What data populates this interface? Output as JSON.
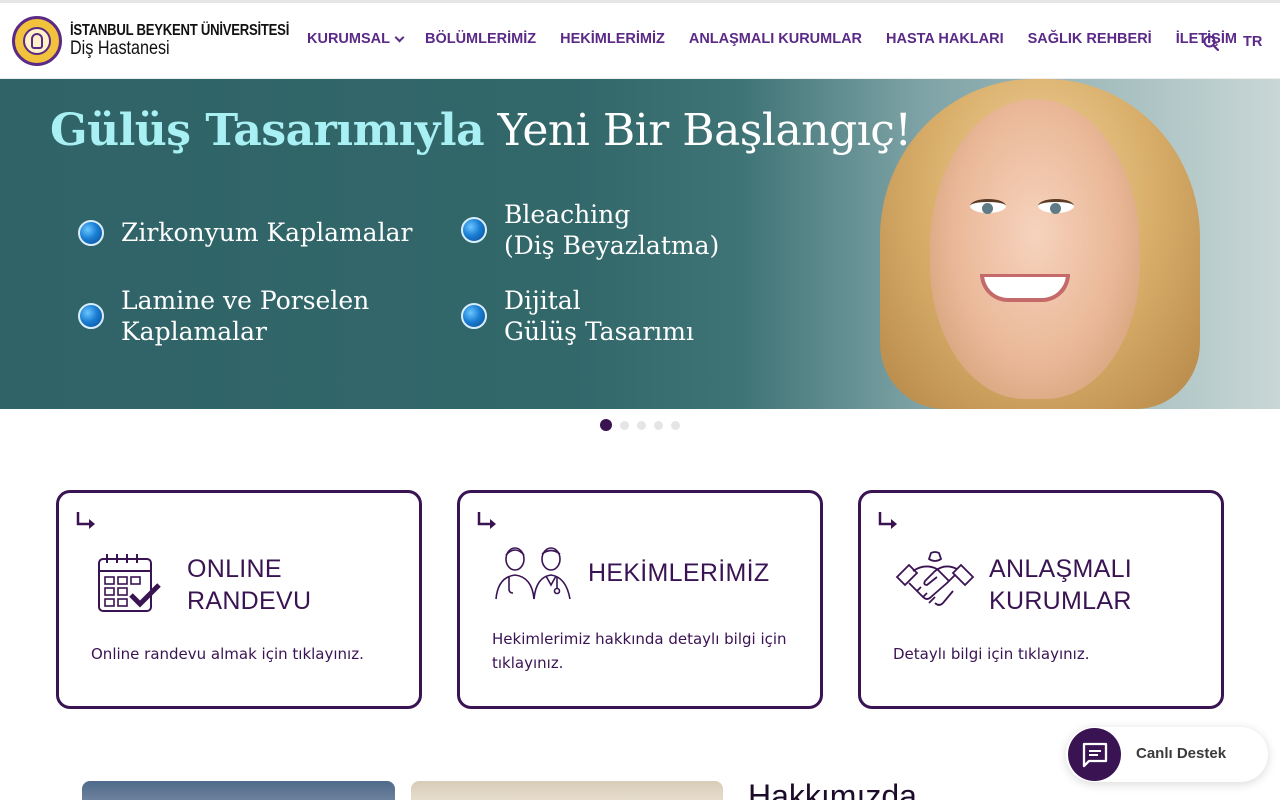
{
  "header": {
    "logo_line1": "İSTANBUL BEYKENT ÜNİVERSİTESİ",
    "logo_line2": "Diş Hastanesi",
    "nav": [
      {
        "label": "KURUMSAL"
      },
      {
        "label": "BÖLÜMLERİMİZ"
      },
      {
        "label": "HEKİMLERİMİZ"
      },
      {
        "label": "ANLAŞMALI KURUMLAR"
      },
      {
        "label": "HASTA HAKLARI"
      },
      {
        "label": "SAĞLIK REHBERİ"
      },
      {
        "label": "İLETİŞİM"
      }
    ],
    "search_icon": "search-icon",
    "language": "TR"
  },
  "hero": {
    "title_strong": "Gülüş Tasarımıyla",
    "title_rest": "Yeni Bir Başlangıç!",
    "features": [
      {
        "line1": "Zirkonyum Kaplamalar",
        "line2": ""
      },
      {
        "line1": "Bleaching",
        "line2": "(Diş Beyazlatma)"
      },
      {
        "line1": "Lamine ve Porselen",
        "line2": "Kaplamalar"
      },
      {
        "line1": "Dijital",
        "line2": "Gülüş Tasarımı"
      }
    ],
    "slides_total": 5,
    "active_slide": 1
  },
  "cards": [
    {
      "title1": "ONLINE",
      "title2": "RANDEVU",
      "desc": "Online randevu almak için tıklayınız.",
      "icon": "calendar-check-icon"
    },
    {
      "title1": "HEKİMLERİMİZ",
      "title2": "",
      "desc": "Hekimlerimiz hakkında detaylı bilgi için tıklayınız.",
      "icon": "doctors-icon"
    },
    {
      "title1": "ANLAŞMALI",
      "title2": "KURUMLAR",
      "desc": "Detaylı bilgi için tıklayınız.",
      "icon": "handshake-icon"
    }
  ],
  "about": {
    "heading": "Hakkımızda"
  },
  "chat": {
    "label": "Canlı Destek",
    "icon": "chat-icon"
  },
  "colors": {
    "brand_purple": "#3a1353",
    "nav_purple": "#5b2a86",
    "hero_teal": "#33686b",
    "title_cyan": "#a8f0f4"
  }
}
